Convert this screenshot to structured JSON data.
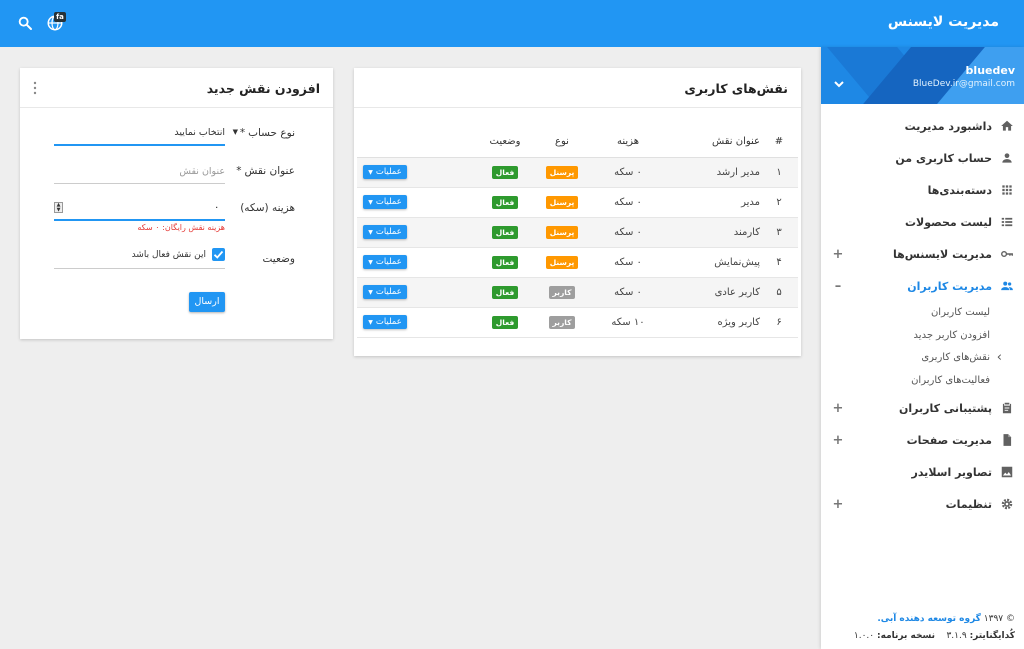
{
  "header": {
    "app_title": "مدیریت لایسنس",
    "language_badge": "fa"
  },
  "sidebar": {
    "username": "bluedev",
    "email": "BlueDev.ir@gmail.com",
    "items": [
      {
        "label": "داشبورد مدیریت",
        "icon": "home-icon",
        "expand": ""
      },
      {
        "label": "حساب کاربری من",
        "icon": "person-icon",
        "expand": ""
      },
      {
        "label": "دسته‌بندی‌ها",
        "icon": "grid-icon",
        "expand": ""
      },
      {
        "label": "لیست محصولات",
        "icon": "list-icon",
        "expand": ""
      },
      {
        "label": "مدیریت لایسنس‌ها",
        "icon": "key-icon",
        "expand": "+"
      },
      {
        "label": "مدیریت کاربران",
        "icon": "people-icon",
        "expand": "–"
      }
    ],
    "subitems": [
      "لیست کاربران",
      "افزودن کاربر جدید",
      "نقش‌های کاربری",
      "فعالیت‌های کاربران"
    ],
    "items_after": [
      {
        "label": "پشتیبانی کاربران",
        "icon": "clipboard-icon",
        "expand": "+"
      },
      {
        "label": "مدیریت صفحات",
        "icon": "document-icon",
        "expand": "+"
      },
      {
        "label": "تصاویر اسلایدر",
        "icon": "image-icon",
        "expand": ""
      },
      {
        "label": "تنظیمات",
        "icon": "gear-icon",
        "expand": "+"
      }
    ],
    "footer": {
      "copyright": "© ۱۳۹۷",
      "company": "گروه توسعه دهنده آبی.",
      "codeigniter_label": "کُدایگنایتر:",
      "codeigniter_version": "۳.۱.۹",
      "app_version_label": "نسخه برنامه:",
      "app_version": "۱.۰.۰"
    }
  },
  "roles_card": {
    "title": "نقش‌های کاربری",
    "columns": [
      "#",
      "عنوان نقش",
      "هزینه",
      "نوع",
      "وضعیت",
      ""
    ],
    "ops_label": "عملیات",
    "rows": [
      {
        "num": "۱",
        "title": "مدیر ارشد",
        "cost": "۰ سکه",
        "type": "پرسنل",
        "status": "فعال"
      },
      {
        "num": "۲",
        "title": "مدیر",
        "cost": "۰ سکه",
        "type": "پرسنل",
        "status": "فعال"
      },
      {
        "num": "۳",
        "title": "کارمند",
        "cost": "۰ سکه",
        "type": "پرسنل",
        "status": "فعال"
      },
      {
        "num": "۴",
        "title": "پیش‌نمایش",
        "cost": "۰ سکه",
        "type": "پرسنل",
        "status": "فعال"
      },
      {
        "num": "۵",
        "title": "کاربر عادی",
        "cost": "۰ سکه",
        "type": "کاربر",
        "status": "فعال"
      },
      {
        "num": "۶",
        "title": "کاربر ویژه",
        "cost": "۱۰ سکه",
        "type": "کاربر",
        "status": "فعال"
      }
    ]
  },
  "form_card": {
    "title": "افزودن نقش جدید",
    "account_type_label": "نوع حساب",
    "account_type_value": "انتخاب نمایید",
    "role_title_label": "عنوان نقش",
    "role_title_placeholder": "عنوان نقش",
    "cost_label": "هزینه (سکه)",
    "cost_value": "۰",
    "cost_hint": "هزینه نقش رایگان: ۰ سکه",
    "status_label": "وضعیت",
    "active_checkbox_label": "این نقش فعال باشد",
    "submit_label": "ارسال",
    "required_mark": "*"
  },
  "colors": {
    "primary": "#2196f3",
    "badge_staff": "#ff9800",
    "badge_user": "#9e9e9e",
    "badge_active": "#2e9a2e"
  }
}
